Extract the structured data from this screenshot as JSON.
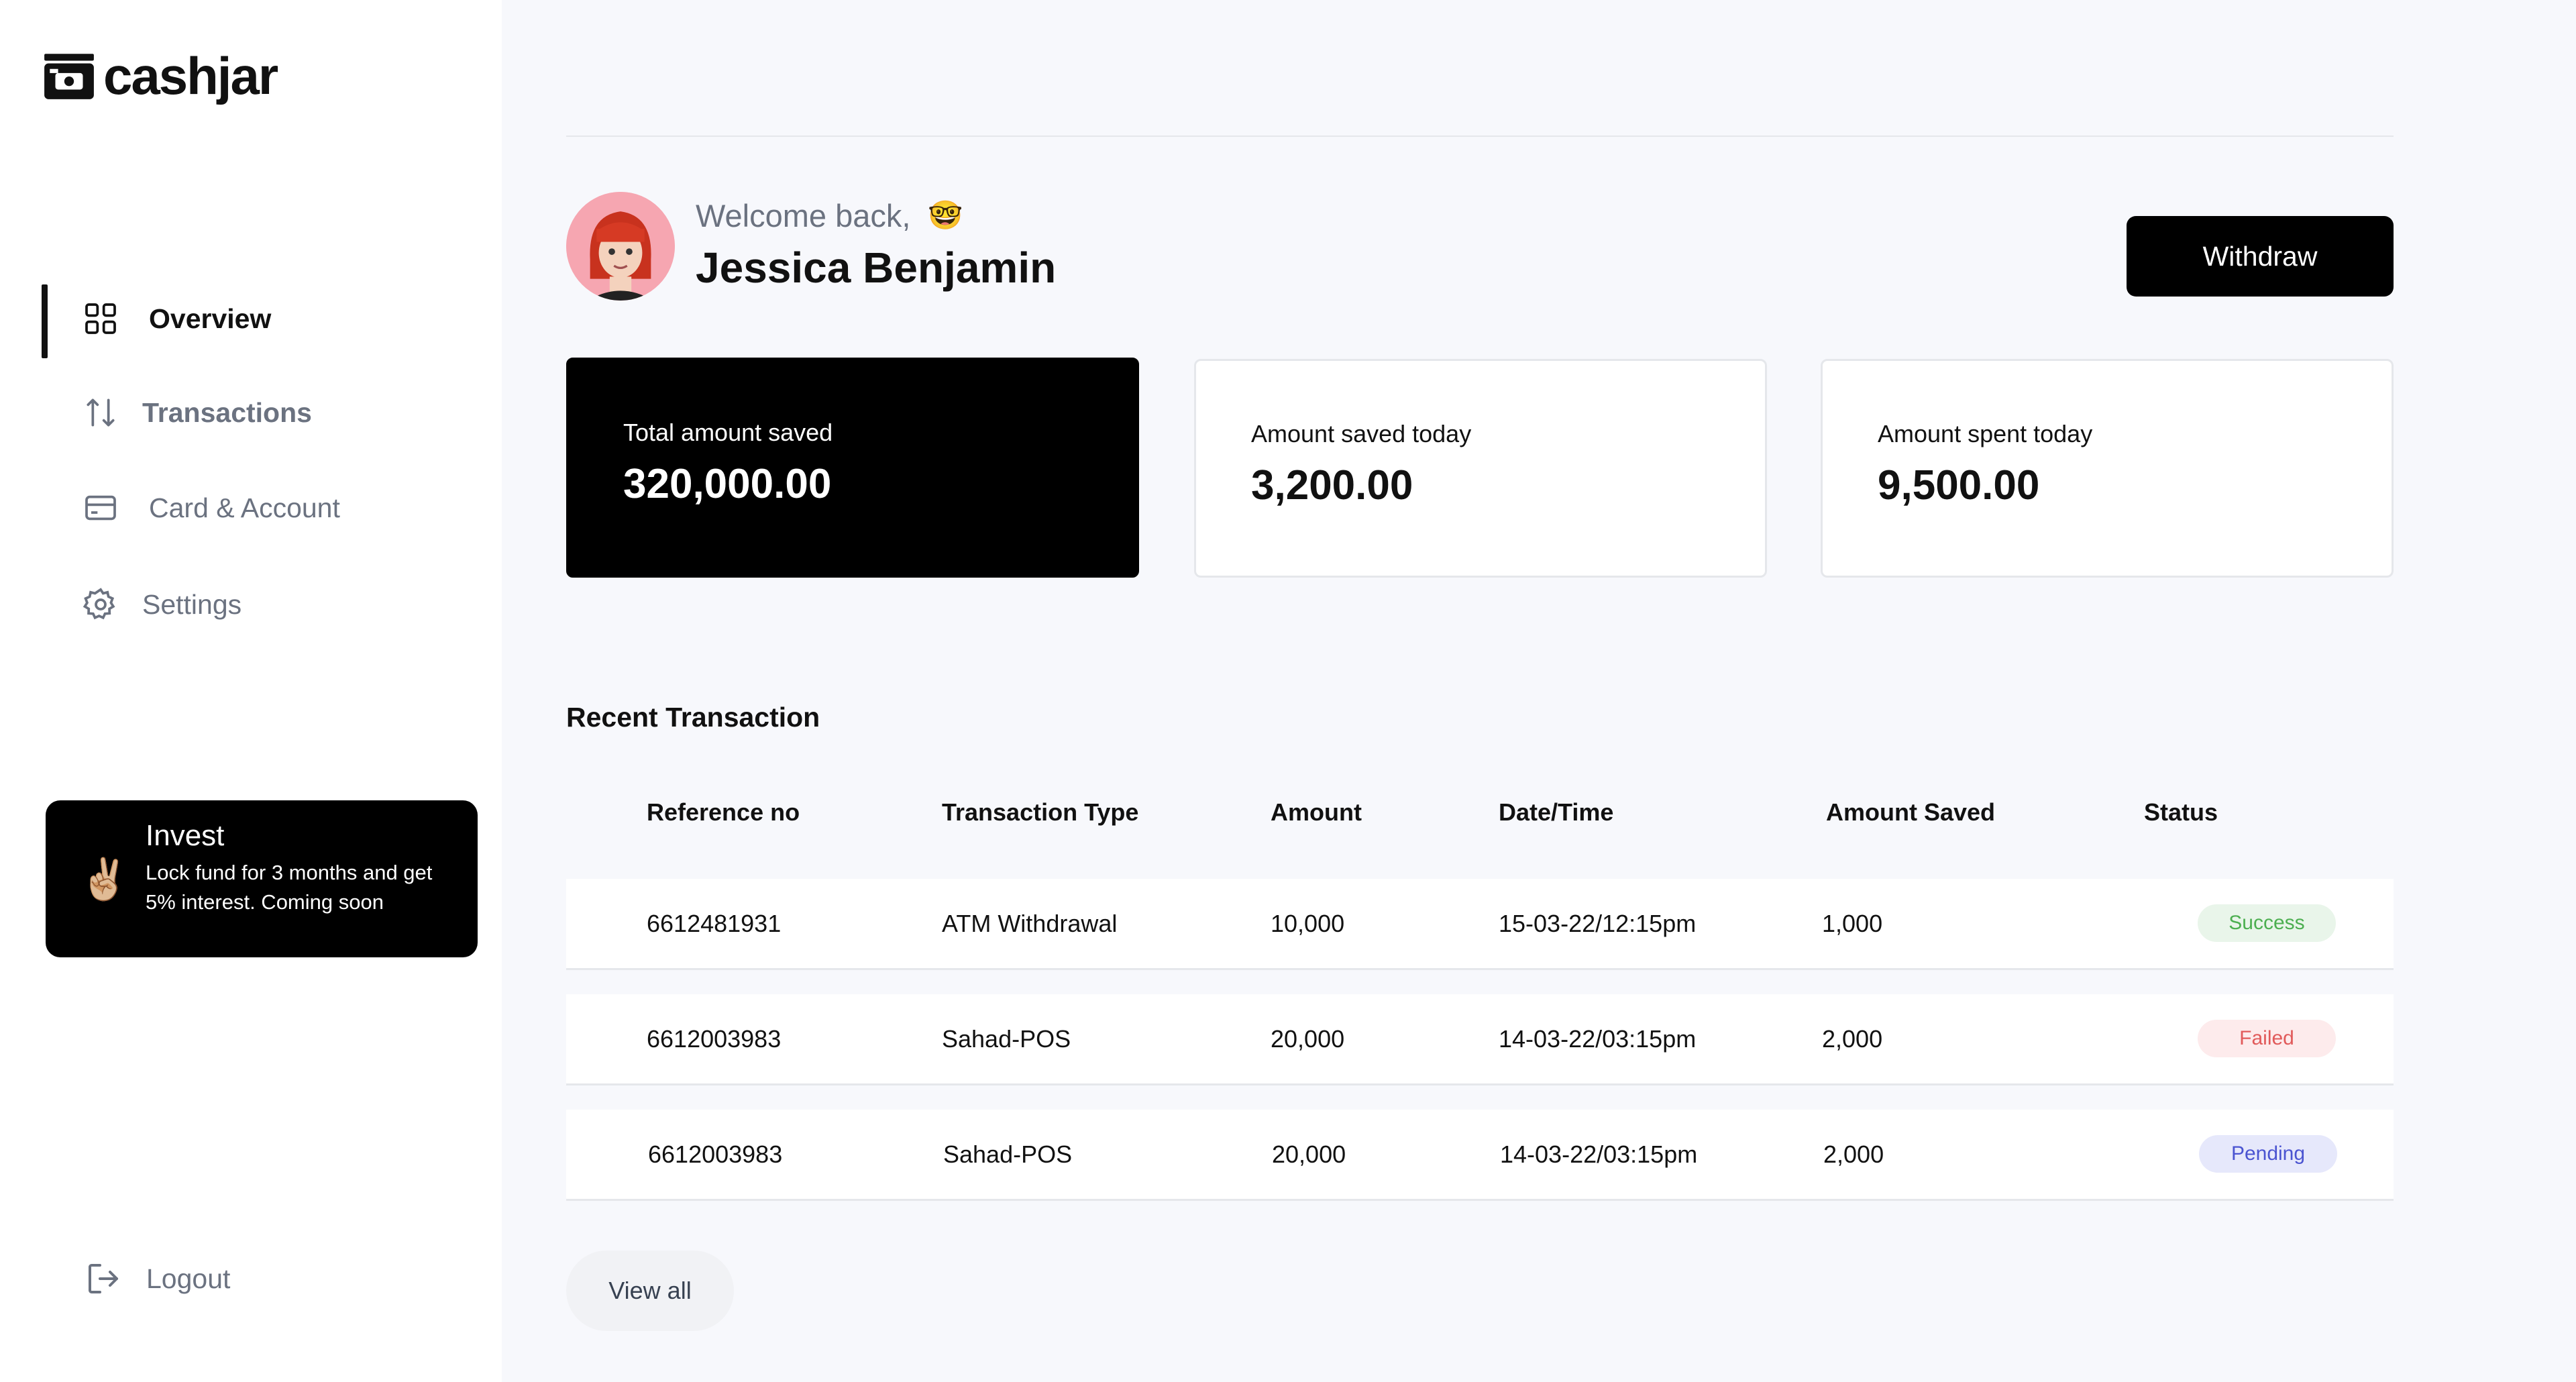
{
  "brand": {
    "name": "cashjar"
  },
  "sidebar": {
    "items": [
      {
        "label": "Overview",
        "icon": "grid-icon",
        "active": true
      },
      {
        "label": "Transactions",
        "icon": "arrows-up-down-icon"
      },
      {
        "label": "Card & Account",
        "icon": "credit-card-icon"
      },
      {
        "label": "Settings",
        "icon": "gear-icon"
      }
    ],
    "invest": {
      "title": "Invest",
      "description": "Lock fund for 3 months and get 5% interest. Coming soon",
      "icon": "✌🏼"
    },
    "logout_label": "Logout"
  },
  "header": {
    "welcome": "Welcome back,",
    "welcome_emoji": "🤓",
    "user_name": "Jessica Benjamin",
    "withdraw_label": "Withdraw"
  },
  "stats": [
    {
      "label": "Total amount saved",
      "value": "320,000.00"
    },
    {
      "label": "Amount saved today",
      "value": "3,200.00"
    },
    {
      "label": "Amount spent today",
      "value": "9,500.00"
    }
  ],
  "transactions": {
    "title": "Recent Transaction",
    "columns": [
      "Reference no",
      "Transaction Type",
      "Amount",
      "Date/Time",
      "Amount Saved",
      "Status"
    ],
    "rows": [
      {
        "ref": "6612481931",
        "type": "ATM Withdrawal",
        "amount": "10,000",
        "datetime": "15-03-22/12:15pm",
        "saved": "1,000",
        "status": "Success"
      },
      {
        "ref": "6612003983",
        "type": "Sahad-POS",
        "amount": "20,000",
        "datetime": "14-03-22/03:15pm",
        "saved": "2,000",
        "status": "Failed"
      },
      {
        "ref": "6612003983",
        "type": "Sahad-POS",
        "amount": "20,000",
        "datetime": "14-03-22/03:15pm",
        "saved": "2,000",
        "status": "Pending"
      }
    ],
    "view_all_label": "View all"
  },
  "colors": {
    "accent": "#000000",
    "background": "#f7f8fc",
    "success": "#4caf50",
    "failed": "#e15a5a",
    "pending": "#4b54d1"
  }
}
